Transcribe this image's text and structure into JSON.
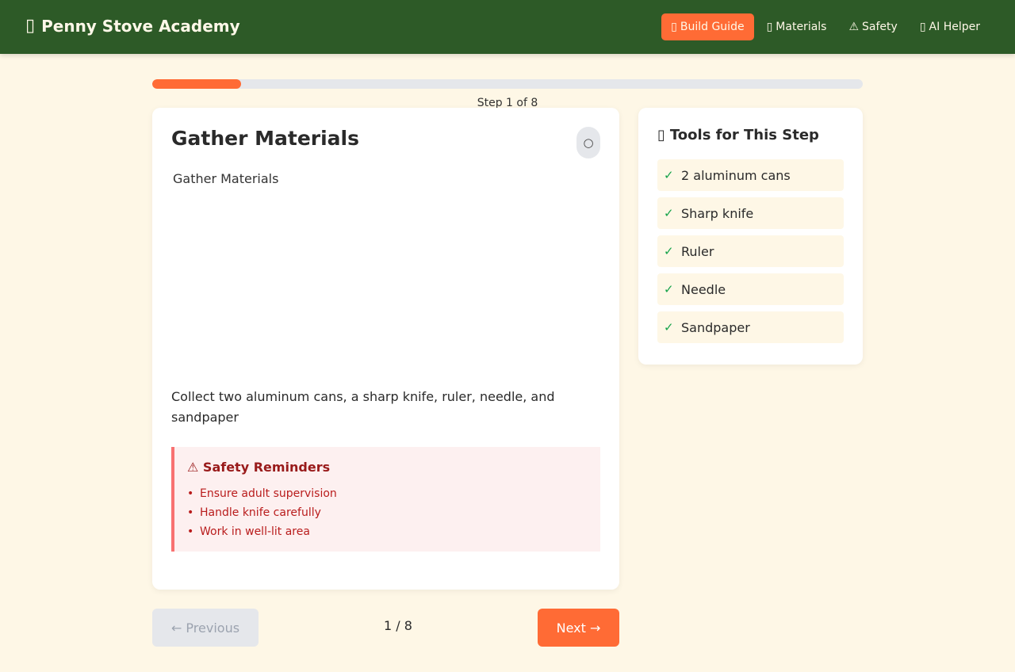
{
  "header": {
    "brand_glyph": "▯",
    "brand_title": "Penny Stove Academy",
    "nav": [
      {
        "glyph": "▯",
        "label": "Build Guide",
        "active": true
      },
      {
        "glyph": "▯",
        "label": "Materials",
        "active": false
      },
      {
        "glyph": "⚠",
        "label": "Safety",
        "active": false
      },
      {
        "glyph": "▯",
        "label": "AI Helper",
        "active": false
      }
    ]
  },
  "progress": {
    "fraction": 0.125,
    "label": "Step 1 of 8"
  },
  "step": {
    "title": "Gather Materials",
    "check_glyph": "○",
    "image_alt": "Gather Materials",
    "description": "Collect two aluminum cans, a sharp knife, ruler, needle, and sandpaper",
    "safety_title": "⚠ Safety Reminders",
    "safety_items": [
      "Ensure adult supervision",
      "Handle knife carefully",
      "Work in well-lit area"
    ]
  },
  "tools": {
    "glyph": "▯",
    "title": "Tools for This Step",
    "items": [
      "2 aluminum cans",
      "Sharp knife",
      "Ruler",
      "Needle",
      "Sandpaper"
    ]
  },
  "pagination": {
    "previous_label": "← Previous",
    "page_text": "1 / 8",
    "next_label": "Next →"
  },
  "colors": {
    "header_bg": "#2d5a27",
    "accent": "#ff6b35",
    "page_bg": "#fef7e6",
    "check": "#16a34a",
    "danger": "#b91c1c"
  }
}
